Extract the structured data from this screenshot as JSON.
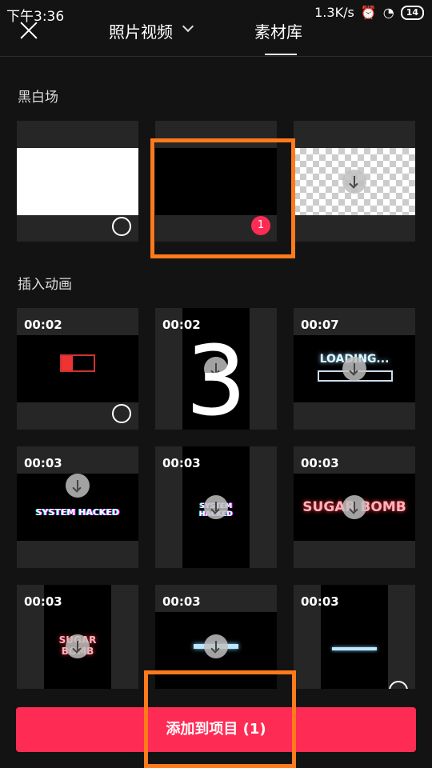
{
  "status": {
    "time": "下午3:36",
    "speed": "1.3K/s",
    "battery": "14"
  },
  "tabs": {
    "photos": "照片视频",
    "library": "素材库"
  },
  "sections": {
    "bw": "黑白场",
    "anim": "插入动画"
  },
  "bw_tiles": [
    {
      "name": "white",
      "selected": false
    },
    {
      "name": "black",
      "selected": true,
      "badge": "1"
    },
    {
      "name": "transparent",
      "download": true
    }
  ],
  "anim_tiles": [
    {
      "duration": "00:02"
    },
    {
      "duration": "00:02"
    },
    {
      "duration": "00:07",
      "text": "LOADING..."
    },
    {
      "duration": "00:03",
      "text": "SYSTEM HACKED"
    },
    {
      "duration": "00:03",
      "text": "SYSTEM HACKED"
    },
    {
      "duration": "00:03",
      "text": "SUGAR BOMB"
    },
    {
      "duration": "00:03",
      "text": "SUGAR BOMB"
    },
    {
      "duration": "00:03"
    },
    {
      "duration": "00:03"
    }
  ],
  "add_button": "添加到项目 (1)",
  "overlay_number": "3",
  "colors": {
    "accent": "#fe2c55",
    "annotation": "#ff7a1a"
  }
}
